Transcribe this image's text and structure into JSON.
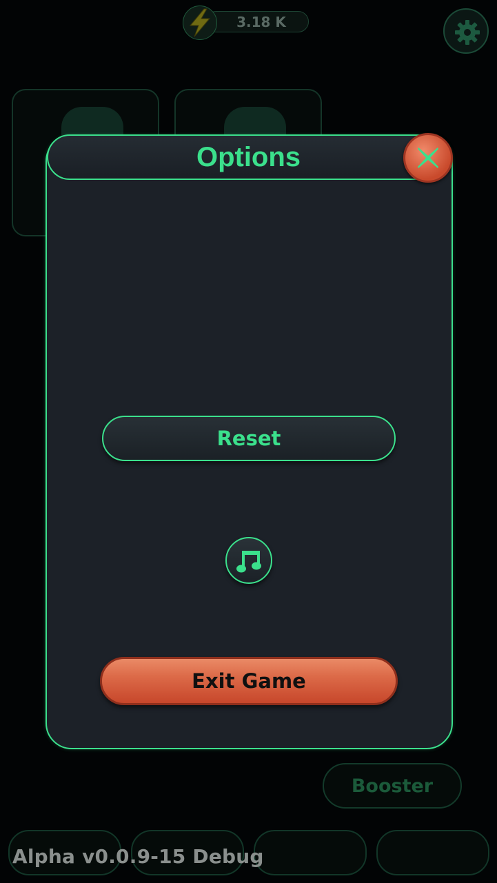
{
  "hud": {
    "energy_value": "3.18 K",
    "energy_icon": "lightning-bolt-icon",
    "settings_icon": "gear-icon"
  },
  "options_dialog": {
    "title": "Options",
    "close_icon": "close-x-icon",
    "reset_label": "Reset",
    "music_icon": "music-note-icon",
    "exit_label": "Exit Game"
  },
  "background": {
    "booster_label": "Booster",
    "version_label": "Alpha v0.0.9-15 Debug"
  },
  "colors": {
    "accent_green": "#3be08c",
    "exit_orange": "#dc6a48",
    "panel_bg": "#1c2128"
  }
}
